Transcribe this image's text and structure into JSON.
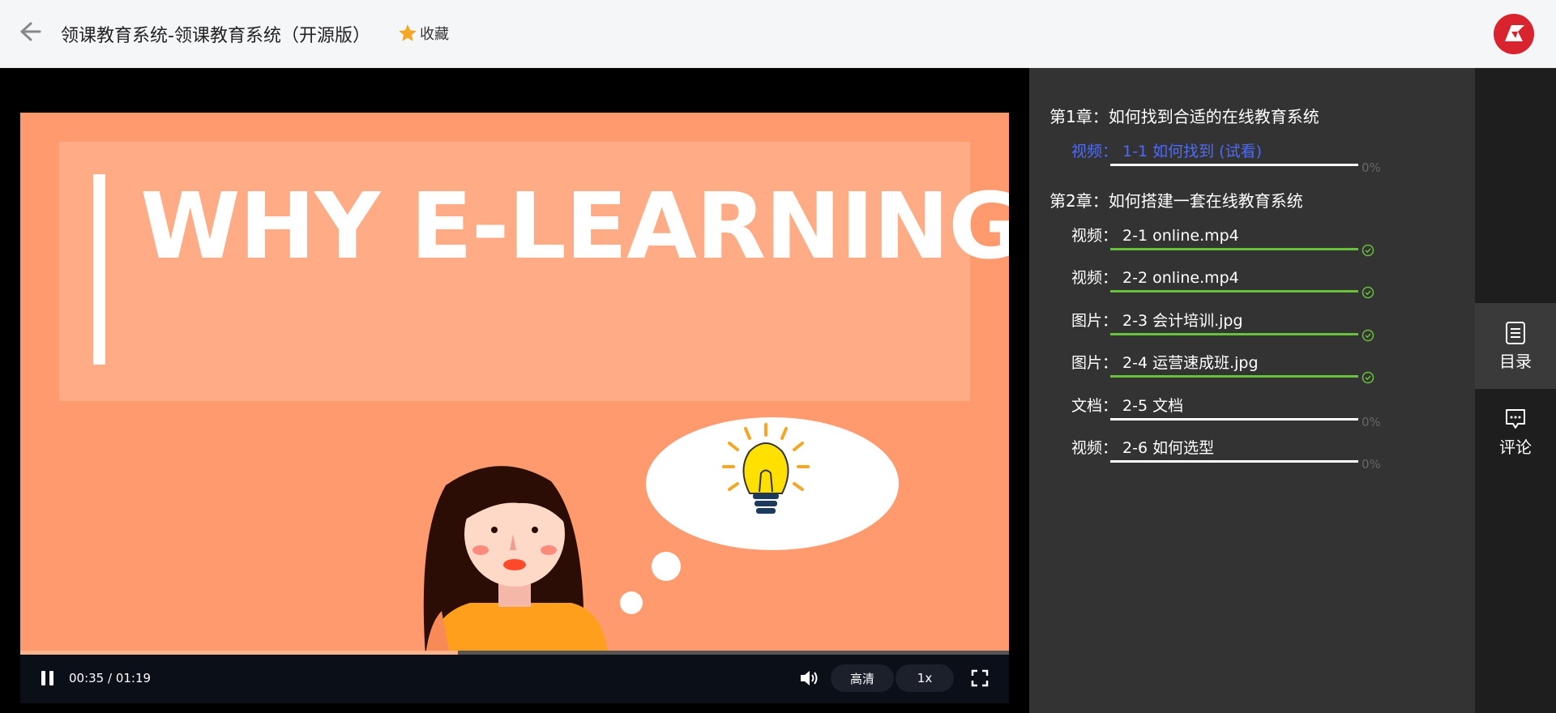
{
  "header": {
    "title": "领课教育系统-领课教育系统（开源版）",
    "favorite_label": "收藏"
  },
  "video": {
    "heading": "WHY E-LEARNING",
    "time_display": "00:35 / 01:19",
    "played_fraction": 0.443,
    "quality_label": "高清",
    "speed_label": "1x"
  },
  "chapters": [
    {
      "title": "第1章：如何找到合适的在线教育系统",
      "lessons": [
        {
          "label": "视频：  1-1 如何找到 (试看)",
          "progress": "0%",
          "done": false,
          "active": true
        }
      ]
    },
    {
      "title": "第2章：如何搭建一套在线教育系统",
      "lessons": [
        {
          "label": "视频：  2-1 online.mp4",
          "progress": "",
          "done": true,
          "active": false
        },
        {
          "label": "视频：  2-2 online.mp4",
          "progress": "",
          "done": true,
          "active": false
        },
        {
          "label": "图片：  2-3 会计培训.jpg",
          "progress": "",
          "done": true,
          "active": false
        },
        {
          "label": "图片：  2-4 运营速成班.jpg",
          "progress": "",
          "done": true,
          "active": false
        },
        {
          "label": "文档：  2-5 文档",
          "progress": "0%",
          "done": false,
          "active": false
        },
        {
          "label": "视频：  2-6 如何选型",
          "progress": "0%",
          "done": false,
          "active": false
        }
      ]
    }
  ],
  "side_tabs": {
    "catalog_label": "目录",
    "comments_label": "评论"
  },
  "colors": {
    "accent": "#4d6aff",
    "done": "#67c23a",
    "favorite": "#f5a623",
    "brand": "#d9232e"
  },
  "icons": [
    "back-arrow-icon",
    "star-icon",
    "brand-logo",
    "pause-icon",
    "volume-icon",
    "fullscreen-icon",
    "check-circle-icon",
    "list-icon",
    "comment-icon"
  ]
}
